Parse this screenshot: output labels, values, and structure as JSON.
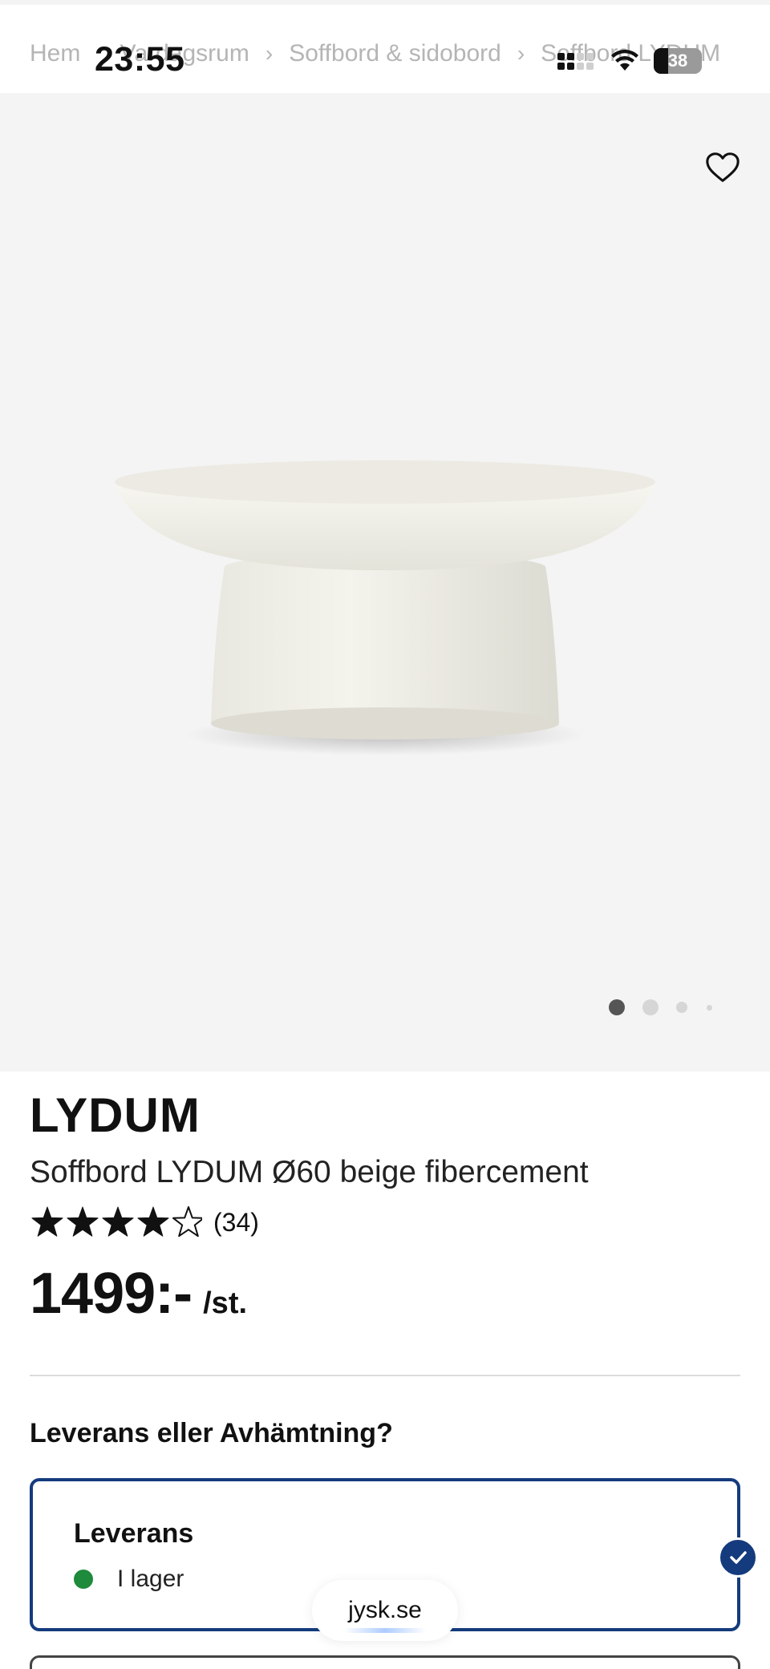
{
  "status_bar": {
    "time": "23:55",
    "battery": "38"
  },
  "breadcrumb": {
    "items": [
      "Hem",
      "Vardagsrum",
      "Soffbord & sidobord",
      "Soffbord LYDUM"
    ],
    "separator": "›"
  },
  "gallery": {
    "favorite_icon": "heart-outline-icon",
    "image_alt": "Soffbord LYDUM",
    "slide_count": 4,
    "active_slide": 1
  },
  "product": {
    "brand": "LYDUM",
    "name": "Soffbord LYDUM Ø60 beige fibercement",
    "rating": 4,
    "rating_max": 5,
    "review_count": "(34)",
    "price": "1499:-",
    "price_unit": "/st."
  },
  "fulfillment": {
    "title": "Leverans eller Avhämtning?",
    "options": [
      {
        "label": "Leverans",
        "status": "I lager",
        "selected": true
      }
    ]
  },
  "browser": {
    "url": "jysk.se"
  },
  "colors": {
    "accent": "#143b7d",
    "in_stock": "#1e8a3c",
    "gallery_bg": "#f4f4f4"
  }
}
